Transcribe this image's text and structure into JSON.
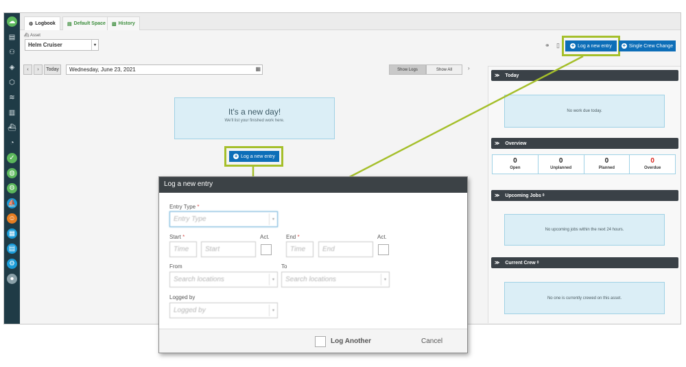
{
  "tabs": [
    {
      "label": "Logbook"
    },
    {
      "label": "Default Space"
    },
    {
      "label": "History"
    }
  ],
  "asset": {
    "label": "Asset",
    "value": "Helm Cruiser"
  },
  "toolbar": {
    "log_entry_label": "Log a new entry",
    "crew_change_label": "Single Crew Change"
  },
  "date_nav": {
    "today_label": "Today",
    "date_value": "Wednesday, June 23, 2021",
    "show_logs": "Show Logs",
    "show_all": "Show All"
  },
  "empty_state": {
    "title": "It's a new day!",
    "subtitle": "We'll list your finished work here.",
    "button_label": "Log a new entry"
  },
  "panels": {
    "today": {
      "title": "Today",
      "message": "No work due today."
    },
    "overview": {
      "title": "Overview",
      "stats": [
        {
          "value": "0",
          "label": "Open",
          "color": "#222222"
        },
        {
          "value": "0",
          "label": "Unplanned",
          "color": "#222222"
        },
        {
          "value": "0",
          "label": "Planned",
          "color": "#222222"
        },
        {
          "value": "0",
          "label": "Overdue",
          "color": "#d9231c"
        }
      ]
    },
    "upcoming": {
      "title": "Upcoming Jobs",
      "count": "0",
      "message": "No upcoming jobs within the next 24 hours."
    },
    "crew": {
      "title": "Current Crew",
      "count": "0",
      "message": "No one is currently crewed on this asset."
    }
  },
  "modal": {
    "title": "Log a new entry",
    "entry_type_label": "Entry Type",
    "entry_type_placeholder": "Entry Type",
    "start_label": "Start",
    "end_label": "End",
    "act_label": "Act.",
    "time_placeholder": "Time",
    "start_placeholder": "Start",
    "end_placeholder": "End",
    "from_label": "From",
    "to_label": "To",
    "search_placeholder": "Search locations",
    "logged_by_label": "Logged by",
    "logged_by_placeholder": "Logged by",
    "log_another_label": "Log Another",
    "cancel_label": "Cancel"
  },
  "colors": {
    "accent_blue": "#0d6eb8",
    "highlight_green": "#a5bf2a",
    "sidebar": "#1f3b46",
    "panel_header": "#3a4147"
  }
}
